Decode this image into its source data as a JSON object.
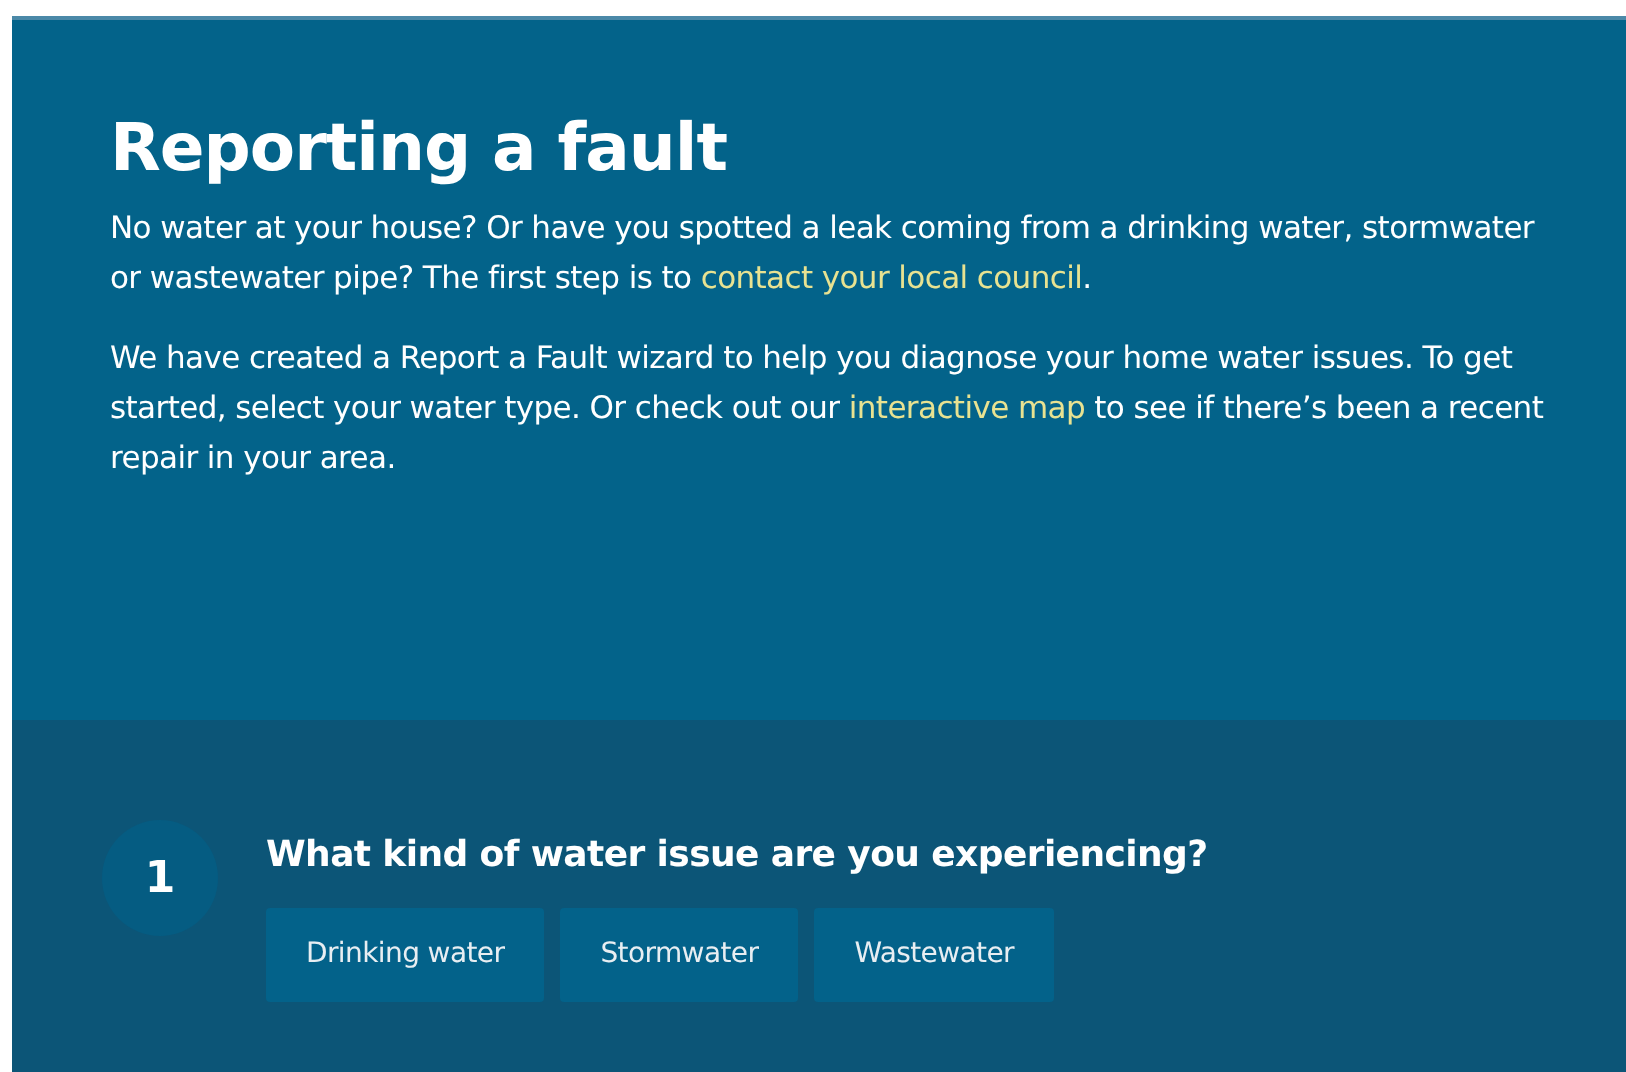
{
  "intro": {
    "title": "Reporting a fault",
    "paragraphs": [
      [
        {
          "kind": "text",
          "text": "No water at your house? Or have you spotted a leak coming from a drinking water, stormwater or wastewater pipe? The first step is to "
        },
        {
          "kind": "link",
          "text": "contact your local council"
        },
        {
          "kind": "text",
          "text": "."
        }
      ],
      [
        {
          "kind": "text",
          "text": "We have created a Report a Fault wizard to help you diagnose your home water issues. To get started, select your water type. Or check out our "
        },
        {
          "kind": "link",
          "text": "interactive map"
        },
        {
          "kind": "text",
          "text": " to see if there’s been a recent repair in your area."
        }
      ]
    ]
  },
  "step": {
    "number": "1",
    "question": "What kind of water issue are you experiencing?",
    "options": [
      "Drinking water",
      "Stormwater",
      "Wastewater"
    ]
  }
}
